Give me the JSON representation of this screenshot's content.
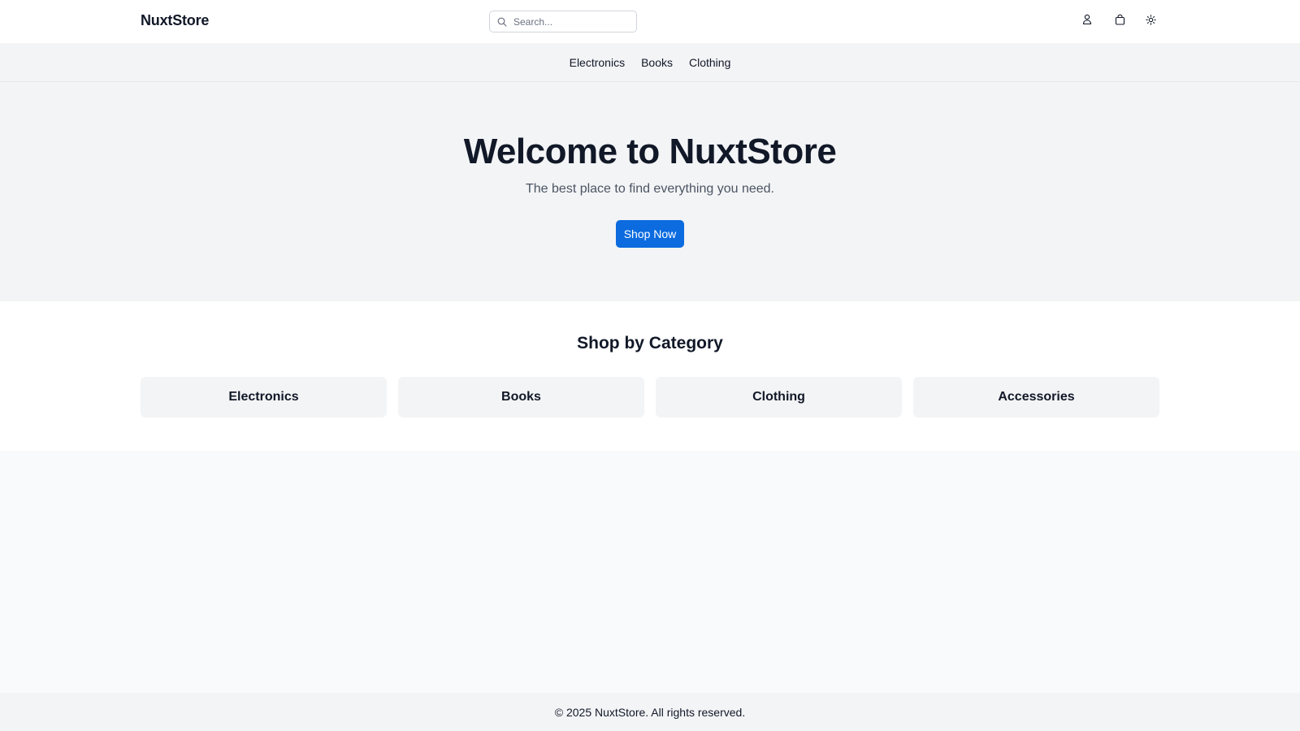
{
  "header": {
    "logo": "NuxtStore",
    "search": {
      "placeholder": "Search...",
      "value": "",
      "icon": "search-icon"
    },
    "icons": [
      "user-icon",
      "shopping-bag-icon",
      "sun-icon"
    ]
  },
  "nav": {
    "items": [
      {
        "label": "Electronics"
      },
      {
        "label": "Books"
      },
      {
        "label": "Clothing"
      }
    ]
  },
  "hero": {
    "title": "Welcome to NuxtStore",
    "subtitle": "The best place to find everything you need.",
    "cta_label": "Shop Now"
  },
  "categories": {
    "title": "Shop by Category",
    "items": [
      {
        "label": "Electronics"
      },
      {
        "label": "Books"
      },
      {
        "label": "Clothing"
      },
      {
        "label": "Accessories"
      }
    ]
  },
  "footer": {
    "text": "© 2025 NuxtStore. All rights reserved."
  },
  "colors": {
    "primary": "#0b6bdf",
    "text": "#111827",
    "muted": "#4b5563",
    "surface": "#f3f4f6",
    "background": "#f9fafb"
  }
}
